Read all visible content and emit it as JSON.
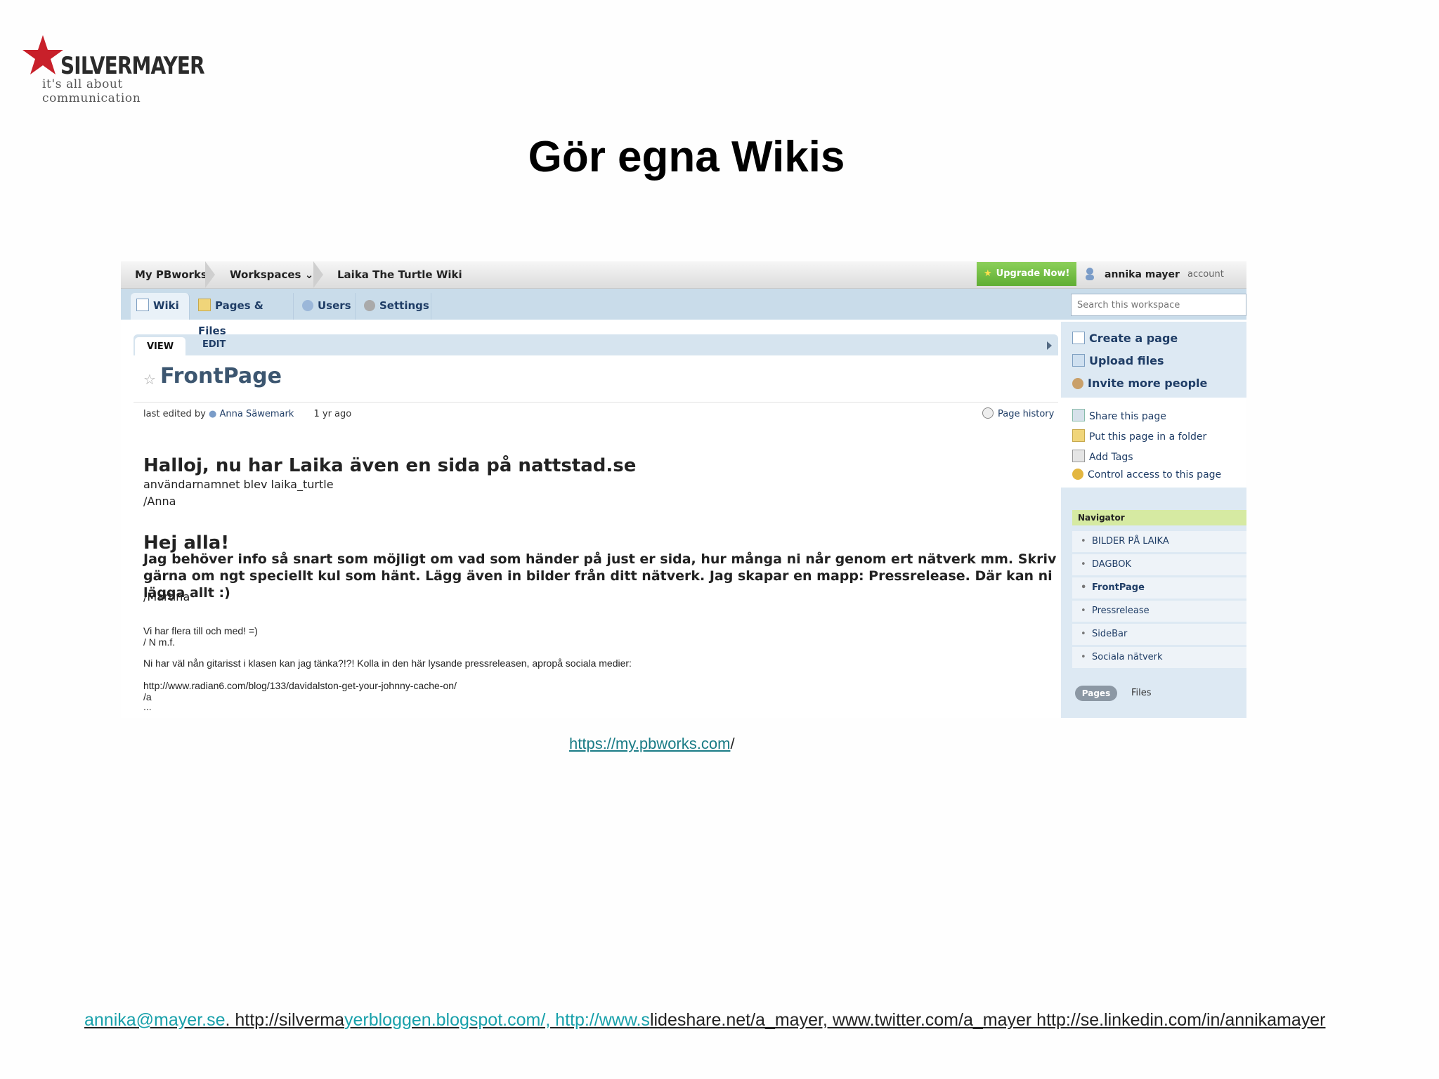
{
  "logo": {
    "brand": "SILVERMAYER",
    "tagline": "it's all about communication"
  },
  "slide_title": "Gör egna Wikis",
  "pbworks": {
    "breadcrumbs": [
      "My PBworks",
      "Workspaces",
      "Laika The Turtle Wiki"
    ],
    "upgrade_label": "Upgrade Now!",
    "user_name": "annika mayer",
    "account_label": "account",
    "tabs": [
      "Wiki",
      "Pages & Files",
      "Users",
      "Settings"
    ],
    "search_placeholder": "Search this workspace",
    "view_label": "VIEW",
    "edit_label": "EDIT",
    "page_title": "FrontPage",
    "meta": {
      "edited_by": "last edited by",
      "author": "Anna Säwemark",
      "ago": "1 yr ago",
      "history": "Page history"
    },
    "body": {
      "h1": "Halloj, nu har Laika även en sida på nattstad.se",
      "p1": "användarnamnet blev laika_turtle",
      "p2": "/Anna",
      "h2": "Hej alla!",
      "p3": "Jag behöver info så snart som möjligt om vad som händer på just er sida, hur många ni når genom ert nätverk mm. Skriv gärna om ngt speciellt kul som hänt. Lägg även in bilder från ditt nätverk. Jag skapar en mapp: Pressrelease. Där kan ni lägga allt :)",
      "p4": "/Martina",
      "s1": "Vi har flera till och med! =)",
      "s2": "/ N m.f.",
      "s3": "Ni har väl nån gitarisst i klasen kan jag tänka?!?! Kolla in den här lysande pressreleasen, apropå sociala medier:",
      "s4": "http://www.radian6.com/blog/133/davidalston-get-your-johnny-cache-on/",
      "s5": "/a",
      "s6": "..."
    },
    "actions_primary": [
      "Create a page",
      "Upload files",
      "Invite more people"
    ],
    "actions_secondary": [
      "Share this page",
      "Put this page in a folder",
      "Add Tags",
      "Control access to this page"
    ],
    "navigator": {
      "title": "Navigator",
      "items": [
        "BILDER PÅ LAIKA",
        "DAGBOK",
        "FrontPage",
        "Pressrelease",
        "SideBar",
        "Sociala nätverk"
      ],
      "pages_label": "Pages",
      "files_label": "Files"
    }
  },
  "pbworks_link": {
    "url": "https://my.pbworks.com",
    "suffix": "/"
  },
  "footer": {
    "email": "annika@mayer.se",
    "part1": ". http://silverma",
    "part2": "yerbloggen.blogspot.com/, http://www.s",
    "part3": "lideshare.net/a_mayer, www.twitter.com/a_mayer http://se.linkedin.com/in/annikamayer"
  },
  "colors": {
    "accent_link": "#1f3d66",
    "upgrade_green": "#6cbb3c",
    "logo_red": "#c8202a",
    "footer_link": "#17a0aa"
  }
}
